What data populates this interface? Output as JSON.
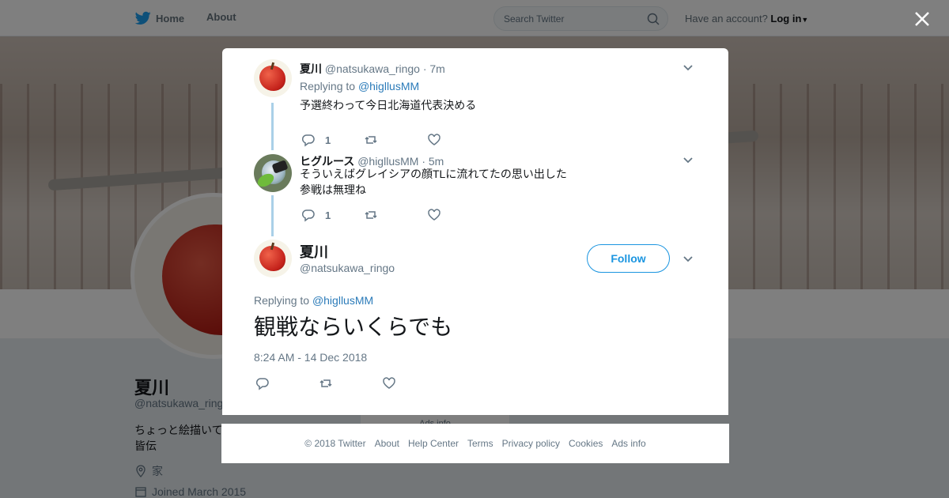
{
  "topbar": {
    "home_label": "Home",
    "about_label": "About",
    "search_placeholder": "Search Twitter",
    "account_prompt": "Have an account?",
    "login_label": "Log in"
  },
  "profile": {
    "name": "夏川",
    "handle": "@natsukawa_ringo",
    "bio": "ちょっと絵描いて\n皆伝",
    "location": "家",
    "joined": "Joined March 2015",
    "ads_info_label": "Ads info"
  },
  "thread": [
    {
      "name": "夏川",
      "handle": "@natsukawa_ringo",
      "time": "· 7m",
      "replying_prefix": "Replying to",
      "replying_to": "@higllusMM",
      "text": "予選終わって今日北海道代表決める",
      "reply_count": "1"
    },
    {
      "name": "ヒグルース",
      "handle": "@higllusMM",
      "time": "· 5m",
      "text": "そういえばグレイシアの顔TLに流れてたの思い出した\n参戦は無理ね",
      "reply_count": "1"
    }
  ],
  "main_tweet": {
    "name": "夏川",
    "handle": "@natsukawa_ringo",
    "follow_label": "Follow",
    "replying_prefix": "Replying to",
    "replying_to": "@higllusMM",
    "text": "観戦ならいくらでも",
    "timestamp": "8:24 AM - 14 Dec 2018"
  },
  "footer": {
    "copyright": "© 2018 Twitter",
    "links": [
      "About",
      "Help Center",
      "Terms",
      "Privacy policy",
      "Cookies",
      "Ads info"
    ]
  },
  "colors": {
    "accent": "#1b95e0",
    "link": "#2b7bb9",
    "thread_line": "#aad0e8",
    "muted": "#657786"
  },
  "icons": [
    "twitter-bird-icon",
    "search-icon",
    "close-icon",
    "reply-icon",
    "retweet-icon",
    "like-icon",
    "chevron-down-icon",
    "location-icon",
    "calendar-icon"
  ]
}
